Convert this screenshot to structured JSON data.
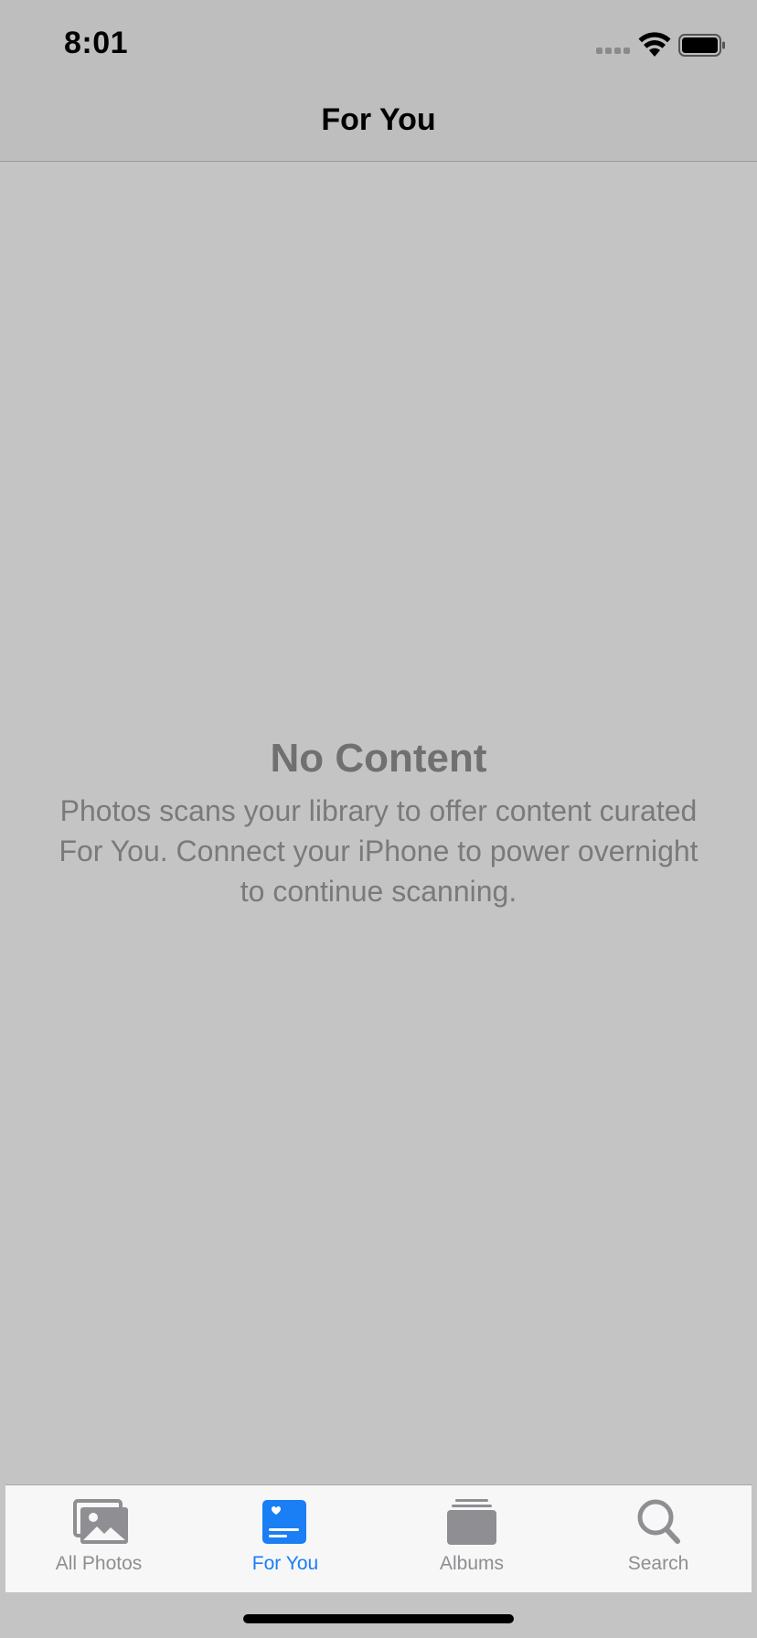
{
  "status_bar": {
    "time": "8:01",
    "icons": [
      "cellular-signal-icon",
      "wifi-icon",
      "battery-icon"
    ]
  },
  "nav_bar": {
    "title": "For You"
  },
  "empty_state": {
    "title": "No Content",
    "body": "Photos scans your library to offer content curated For You. Connect your iPhone to power overnight to continue scanning."
  },
  "tab_bar": {
    "tabs": [
      {
        "label": "All Photos",
        "icon": "photos-icon",
        "active": false
      },
      {
        "label": "For You",
        "icon": "for-you-icon",
        "active": true
      },
      {
        "label": "Albums",
        "icon": "albums-icon",
        "active": false
      },
      {
        "label": "Search",
        "icon": "search-icon",
        "active": false
      }
    ],
    "active_color": "#1a7ef5",
    "inactive_color": "#8e8e93"
  }
}
